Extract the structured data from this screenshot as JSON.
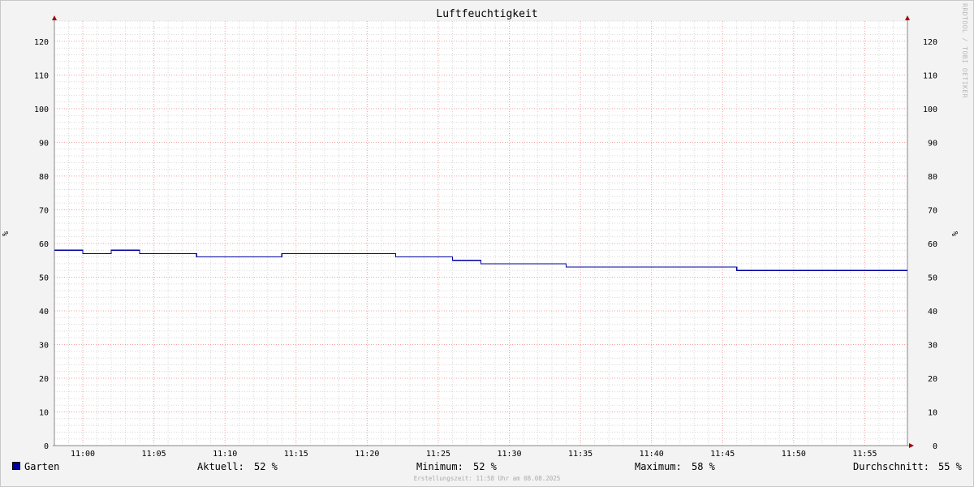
{
  "watermark": "RRDTOOL / TOBI OETIKER",
  "footer_note": "Erstellungszeit: 11:58 Uhr am 08.08.2025",
  "legend": {
    "series_name": "Garten",
    "series_color": "#0000a0",
    "current_label": "Aktuell:",
    "current_value": "52 %",
    "min_label": "Minimum:",
    "min_value": "52 %",
    "max_label": "Maximum:",
    "max_value": "58 %",
    "avg_label": "Durchschnitt:",
    "avg_value": "55 %"
  },
  "chart_data": {
    "type": "line",
    "title": "Luftfeuchtigkeit",
    "ylabel": "%",
    "ylabel_right": "%",
    "xlabel": "",
    "x_range": [
      "10:58",
      "11:58"
    ],
    "ylim": [
      0,
      126
    ],
    "y_ticks": [
      0,
      10,
      20,
      30,
      40,
      50,
      60,
      70,
      80,
      90,
      100,
      110,
      120
    ],
    "x_ticks": [
      "11:00",
      "11:05",
      "11:10",
      "11:15",
      "11:20",
      "11:25",
      "11:30",
      "11:35",
      "11:40",
      "11:45",
      "11:50",
      "11:55"
    ],
    "grid": true,
    "line_style": "step",
    "series": [
      {
        "name": "Garten",
        "color": "#0000a0",
        "points": [
          {
            "x": "10:58",
            "y": 58
          },
          {
            "x": "11:00",
            "y": 57
          },
          {
            "x": "11:02",
            "y": 58
          },
          {
            "x": "11:04",
            "y": 57
          },
          {
            "x": "11:08",
            "y": 56
          },
          {
            "x": "11:14",
            "y": 57
          },
          {
            "x": "11:22",
            "y": 56
          },
          {
            "x": "11:26",
            "y": 55
          },
          {
            "x": "11:28",
            "y": 54
          },
          {
            "x": "11:34",
            "y": 53
          },
          {
            "x": "11:46",
            "y": 52
          },
          {
            "x": "11:58",
            "y": 52
          }
        ]
      }
    ]
  }
}
